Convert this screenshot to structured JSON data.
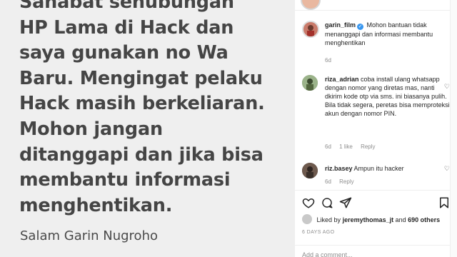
{
  "post": {
    "lines": [
      "Sahabat sehubungan",
      "HP Lama di Hack  dan",
      "saya gunakan no Wa",
      "Baru. Mengingat pelaku",
      "Hack masih berkeliaran.",
      "Mohon jangan",
      "ditanggapi dan jika bisa",
      "membantu informasi",
      "menghentikan."
    ],
    "signature": "Salam Garin Nugroho"
  },
  "caption": {
    "username": "garin_film",
    "text": "Mohon bantuan tidak menanggapi dan informasi membantu menghentikan",
    "time": "6d"
  },
  "comments": [
    {
      "username": "riza_adrian",
      "text": "coba install ulang whatsapp dengan nomor yang diretas mas, nanti dkirim kode otp via sms. ini biasanya pulih. Bila tidak segera, peretas bisa memproteksi akun dengan nomor PIN.",
      "time": "6d",
      "likes": "1 like",
      "reply": "Reply"
    },
    {
      "username": "riz.basey",
      "text": "Ampun itu hacker",
      "time": "6d",
      "reply": "Reply"
    }
  ],
  "likes": {
    "prefix": "Liked by",
    "user": "jeremythomas_jt",
    "and": "and",
    "others": "690 others"
  },
  "posted_ago": "6 DAYS AGO",
  "add_comment_placeholder": "Add a comment...",
  "colors": {
    "verified": "#3897f0",
    "muted": "#8e8e8e",
    "text": "#262626"
  }
}
